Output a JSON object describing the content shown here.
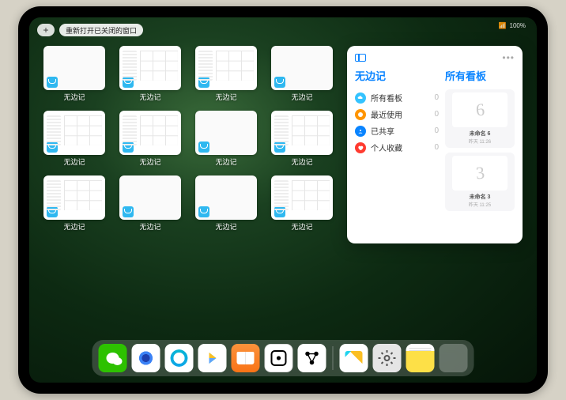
{
  "status": {
    "signal": "📶",
    "battery": "100%"
  },
  "topbar": {
    "plus": "+",
    "reopen_label": "重新打开已关闭的窗口"
  },
  "app_name": "无边记",
  "windows": [
    {
      "style": "blank",
      "label": "无边记"
    },
    {
      "style": "grid",
      "label": "无边记"
    },
    {
      "style": "grid",
      "label": "无边记"
    },
    {
      "style": "blank",
      "label": "无边记"
    },
    {
      "style": "grid",
      "label": "无边记"
    },
    {
      "style": "grid",
      "label": "无边记"
    },
    {
      "style": "blank",
      "label": "无边记"
    },
    {
      "style": "grid",
      "label": "无边记"
    },
    {
      "style": "grid",
      "label": "无边记"
    },
    {
      "style": "blank",
      "label": "无边记"
    },
    {
      "style": "blank",
      "label": "无边记"
    },
    {
      "style": "grid",
      "label": "无边记"
    }
  ],
  "panel": {
    "title_left": "无边记",
    "title_right": "所有看板",
    "menu": [
      {
        "icon": "cloud",
        "color": "#34c3ff",
        "label": "所有看板",
        "count": "0"
      },
      {
        "icon": "clock",
        "color": "#ff9500",
        "label": "最近使用",
        "count": "0"
      },
      {
        "icon": "people",
        "color": "#0a84ff",
        "label": "已共享",
        "count": "0"
      },
      {
        "icon": "heart",
        "color": "#ff3b30",
        "label": "个人收藏",
        "count": "0"
      }
    ],
    "boards": [
      {
        "scribble": "6",
        "title": "未命名 6",
        "sub": "昨天 11:26"
      },
      {
        "scribble": "3",
        "title": "未命名 3",
        "sub": "昨天 11:25"
      }
    ]
  },
  "dock": [
    {
      "name": "wechat",
      "class": "di-wechat"
    },
    {
      "name": "qqbrowser",
      "class": "di-qqb"
    },
    {
      "name": "qq",
      "class": "di-qq"
    },
    {
      "name": "play",
      "class": "di-play"
    },
    {
      "name": "books",
      "class": "di-books"
    },
    {
      "name": "dice",
      "class": "di-dice"
    },
    {
      "name": "nodes",
      "class": "di-nodes"
    },
    {
      "name": "freeform",
      "class": "di-freeform"
    },
    {
      "name": "settings",
      "class": "di-settings"
    },
    {
      "name": "notes",
      "class": "di-notes"
    },
    {
      "name": "folder",
      "class": "di-folder"
    }
  ]
}
